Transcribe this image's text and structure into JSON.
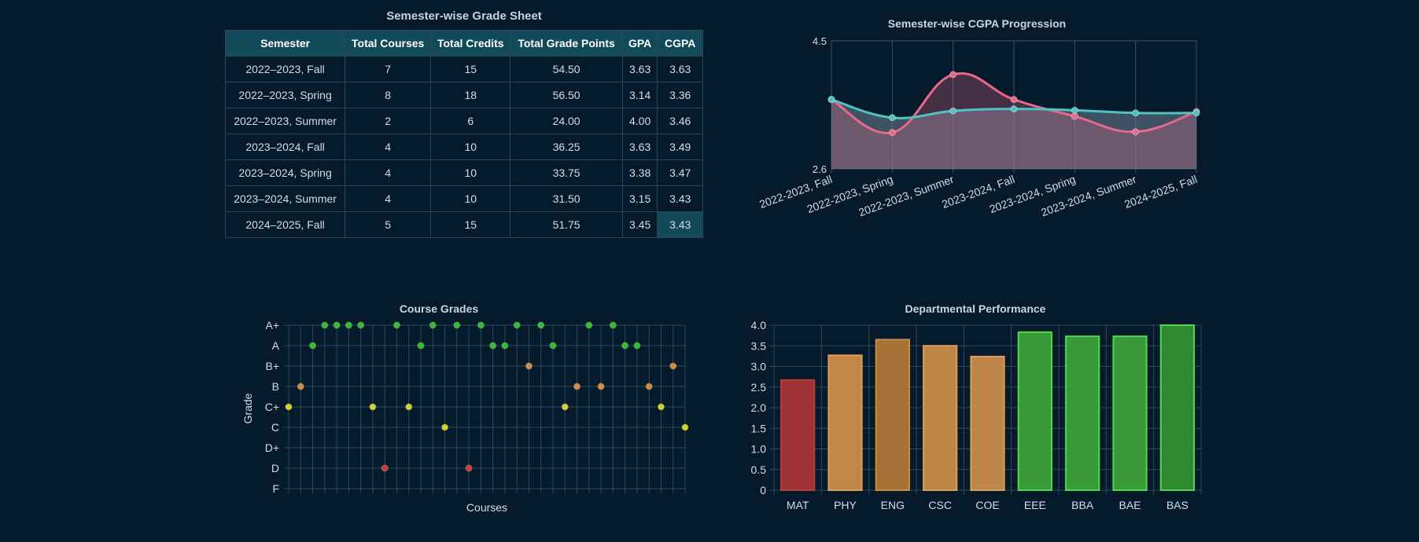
{
  "grade_sheet": {
    "title": "Semester-wise Grade Sheet",
    "headers": [
      "Semester",
      "Total Courses",
      "Total Credits",
      "Total Grade Points",
      "GPA",
      "CGPA"
    ],
    "rows": [
      [
        "2022–2023, Fall",
        "7",
        "15",
        "54.50",
        "3.63",
        "3.63"
      ],
      [
        "2022–2023, Spring",
        "8",
        "18",
        "56.50",
        "3.14",
        "3.36"
      ],
      [
        "2022–2023, Summer",
        "2",
        "6",
        "24.00",
        "4.00",
        "3.46"
      ],
      [
        "2023–2024, Fall",
        "4",
        "10",
        "36.25",
        "3.63",
        "3.49"
      ],
      [
        "2023–2024, Spring",
        "4",
        "10",
        "33.75",
        "3.38",
        "3.47"
      ],
      [
        "2023–2024, Summer",
        "4",
        "10",
        "31.50",
        "3.15",
        "3.43"
      ],
      [
        "2024–2025, Fall",
        "5",
        "15",
        "51.75",
        "3.45",
        "3.43"
      ]
    ]
  },
  "colors": {
    "background": "#051a2b",
    "gpa_line": "#e8698a",
    "cgpa_line": "#4fc3c3",
    "grade_green": "#2fbf2f",
    "grade_orange": "#d98a3c",
    "grade_yellow": "#d8d02a",
    "grade_red": "#d23a3a"
  },
  "chart_data": [
    {
      "type": "line",
      "title": "Semester-wise CGPA Progression",
      "categories": [
        "2022-2023, Fall",
        "2022-2023, Spring",
        "2022-2023, Summer",
        "2023-2024, Fall",
        "2023-2024, Spring",
        "2023-2024, Summer",
        "2024-2025, Fall"
      ],
      "series": [
        {
          "values": [
            3.63,
            3.14,
            4.0,
            3.63,
            3.38,
            3.15,
            3.45
          ]
        },
        {
          "values": [
            3.63,
            3.36,
            3.46,
            3.49,
            3.47,
            3.43,
            3.43
          ]
        }
      ],
      "ylim": [
        2.6,
        4.5
      ],
      "yticks": [
        "4.5",
        "2.6"
      ],
      "grid": true
    },
    {
      "type": "scatter",
      "title": "Course Grades",
      "xlabel": "Courses",
      "ylabel": "Grade",
      "grade_levels": [
        "F",
        "D",
        "D+",
        "C",
        "C+",
        "B",
        "B+",
        "A",
        "A+"
      ],
      "points": [
        "C+",
        "B",
        "A",
        "A+",
        "A+",
        "A+",
        "A+",
        "C+",
        "D",
        "A+",
        "C+",
        "A",
        "A+",
        "C",
        "A+",
        "D",
        "A+",
        "A",
        "A",
        "A+",
        "B+",
        "A+",
        "A",
        "C+",
        "B",
        "A+",
        "B",
        "A+",
        "A",
        "A",
        "B",
        "C+",
        "B+",
        "C"
      ],
      "grid": true
    },
    {
      "type": "bar",
      "title": "Departmental Performance",
      "categories": [
        "MAT",
        "PHY",
        "ENG",
        "CSC",
        "COE",
        "EEE",
        "BBA",
        "BAE",
        "BAS"
      ],
      "values": [
        2.67,
        3.27,
        3.65,
        3.5,
        3.24,
        3.83,
        3.73,
        3.73,
        4.0
      ],
      "bar_colors": [
        "#9e3236",
        "#c28649",
        "#a87137",
        "#be8547",
        "#c08649",
        "#3a9a3a",
        "#3a9a3a",
        "#3a9a3a",
        "#2f8a2f"
      ],
      "border_colors": [
        "#c23a3a",
        "#d99f5a",
        "#cf8a45",
        "#d99f5a",
        "#d99f5a",
        "#4ed84e",
        "#4ed84e",
        "#4ed84e",
        "#4ed84e"
      ],
      "ylim": [
        0,
        4.0
      ],
      "yticks": [
        "0",
        "0.5",
        "1.0",
        "1.5",
        "2.0",
        "2.5",
        "3.0",
        "3.5",
        "4.0"
      ],
      "grid": true
    }
  ]
}
